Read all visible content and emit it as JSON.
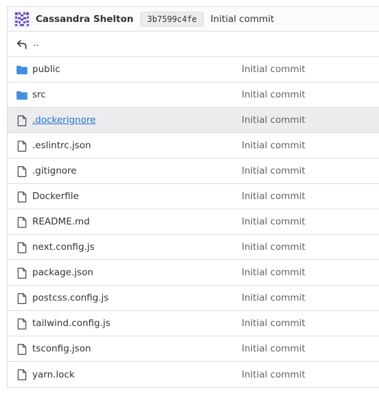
{
  "commit": {
    "author": "Cassandra Shelton",
    "sha": "3b7599c4fe",
    "title": "Initial commit",
    "avatar_icon": "identicon-avatar",
    "avatar_color": "#6b4fbb"
  },
  "parent_dir": {
    "label": "..",
    "icon": "arrow-back-icon"
  },
  "files": [
    {
      "name": "public",
      "type": "folder",
      "last_commit": "Initial commit",
      "icon": "folder-icon"
    },
    {
      "name": "src",
      "type": "folder",
      "last_commit": "Initial commit",
      "icon": "folder-icon"
    },
    {
      "name": ".dockerignore",
      "type": "file",
      "last_commit": "Initial commit",
      "icon": "file-icon",
      "hovered": true
    },
    {
      "name": ".eslintrc.json",
      "type": "file",
      "last_commit": "Initial commit",
      "icon": "file-icon"
    },
    {
      "name": ".gitignore",
      "type": "file",
      "last_commit": "Initial commit",
      "icon": "file-icon"
    },
    {
      "name": "Dockerfile",
      "type": "file",
      "last_commit": "Initial commit",
      "icon": "file-icon"
    },
    {
      "name": "README.md",
      "type": "file",
      "last_commit": "Initial commit",
      "icon": "file-icon"
    },
    {
      "name": "next.config.js",
      "type": "file",
      "last_commit": "Initial commit",
      "icon": "file-icon"
    },
    {
      "name": "package.json",
      "type": "file",
      "last_commit": "Initial commit",
      "icon": "file-icon"
    },
    {
      "name": "postcss.config.js",
      "type": "file",
      "last_commit": "Initial commit",
      "icon": "file-icon"
    },
    {
      "name": "tailwind.config.js",
      "type": "file",
      "last_commit": "Initial commit",
      "icon": "file-icon"
    },
    {
      "name": "tsconfig.json",
      "type": "file",
      "last_commit": "Initial commit",
      "icon": "file-icon"
    },
    {
      "name": "yarn.lock",
      "type": "file",
      "last_commit": "Initial commit",
      "icon": "file-icon"
    }
  ],
  "colors": {
    "folder": "#428fdc",
    "link": "#1f75cb",
    "border": "#dcdcde",
    "hover_bg": "#ececef"
  }
}
